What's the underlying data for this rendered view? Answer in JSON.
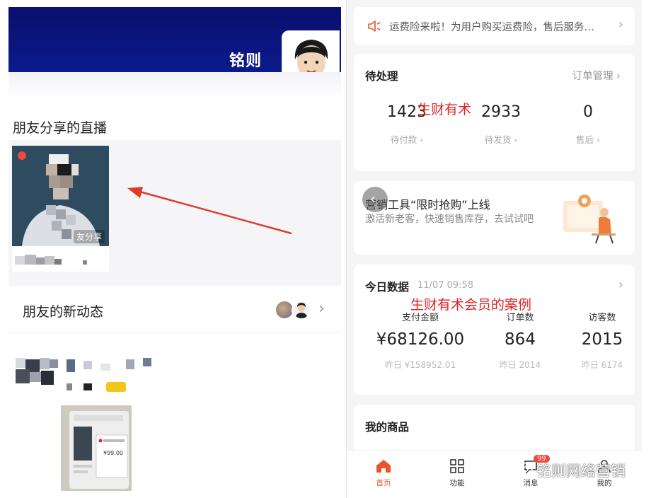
{
  "left": {
    "banner": {
      "name": "铭则"
    },
    "friends_live": {
      "title": "朋友分享的直播",
      "share_tag": "友分享"
    },
    "moments": {
      "title": "朋友的新动态"
    },
    "feed_image": {
      "price": "¥99.00"
    }
  },
  "right": {
    "notice": {
      "text": "运费险来啦！为用户购买运费险，售后服务…",
      "icon": "speaker-icon"
    },
    "pending": {
      "title": "待处理",
      "order_management": "订单管理",
      "watermark": "生财有术",
      "stats": [
        {
          "value": "1423",
          "label": "待付款"
        },
        {
          "value": "2933",
          "label": "待发货"
        },
        {
          "value": "0",
          "label": "售后"
        }
      ]
    },
    "promo": {
      "title": "营销工具“限时抢购”上线",
      "description": "激活新老客，快速销售库存，去试试吧"
    },
    "today": {
      "title": "今日数据",
      "time": "11/07 09:58",
      "watermark": "生财有术会员的案例",
      "stats": [
        {
          "label": "支付金额",
          "value": "¥68126.00",
          "yesterday": "昨日 ¥158952.01"
        },
        {
          "label": "订单数",
          "value": "864",
          "yesterday": "昨日 2014"
        },
        {
          "label": "访客数",
          "value": "2015",
          "yesterday": "昨日 6174"
        }
      ]
    },
    "products": {
      "title": "我的商品"
    },
    "tabs": [
      {
        "label": "首页",
        "icon": "home-icon"
      },
      {
        "label": "功能",
        "icon": "grid-icon"
      },
      {
        "label": "消息",
        "icon": "message-icon",
        "badge": "99"
      },
      {
        "label": "我的",
        "icon": "user-icon"
      }
    ],
    "accent_color": "#e8552c"
  },
  "watermark": {
    "brand": "铭则网络营销"
  }
}
